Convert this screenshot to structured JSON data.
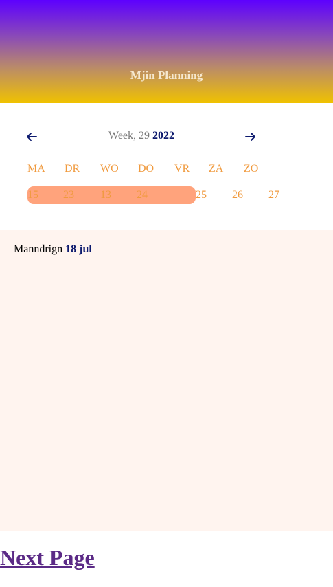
{
  "header": {
    "title": "Mjin Planning"
  },
  "week_nav": {
    "prefix": "Week, 29",
    "year": "2022",
    "prev_icon": "arrow-left-icon",
    "next_icon": "arrow-right-icon"
  },
  "days": {
    "names": [
      "MA",
      "DR",
      "WO",
      "DO",
      "VR",
      "ZA",
      "ZO"
    ],
    "numbers": [
      "15",
      "23",
      "13",
      "24",
      "25",
      "26",
      "27"
    ]
  },
  "selected": {
    "day_label": "Manndrign",
    "date_label": "18 jul"
  },
  "footer": {
    "next_link": "Next Page"
  },
  "colors": {
    "accent_orange": "#f09a3e",
    "highlight": "#ffa37c",
    "navy": "#0d1a6e",
    "link": "#5b2a86",
    "panel_bg": "#fff4ef"
  }
}
